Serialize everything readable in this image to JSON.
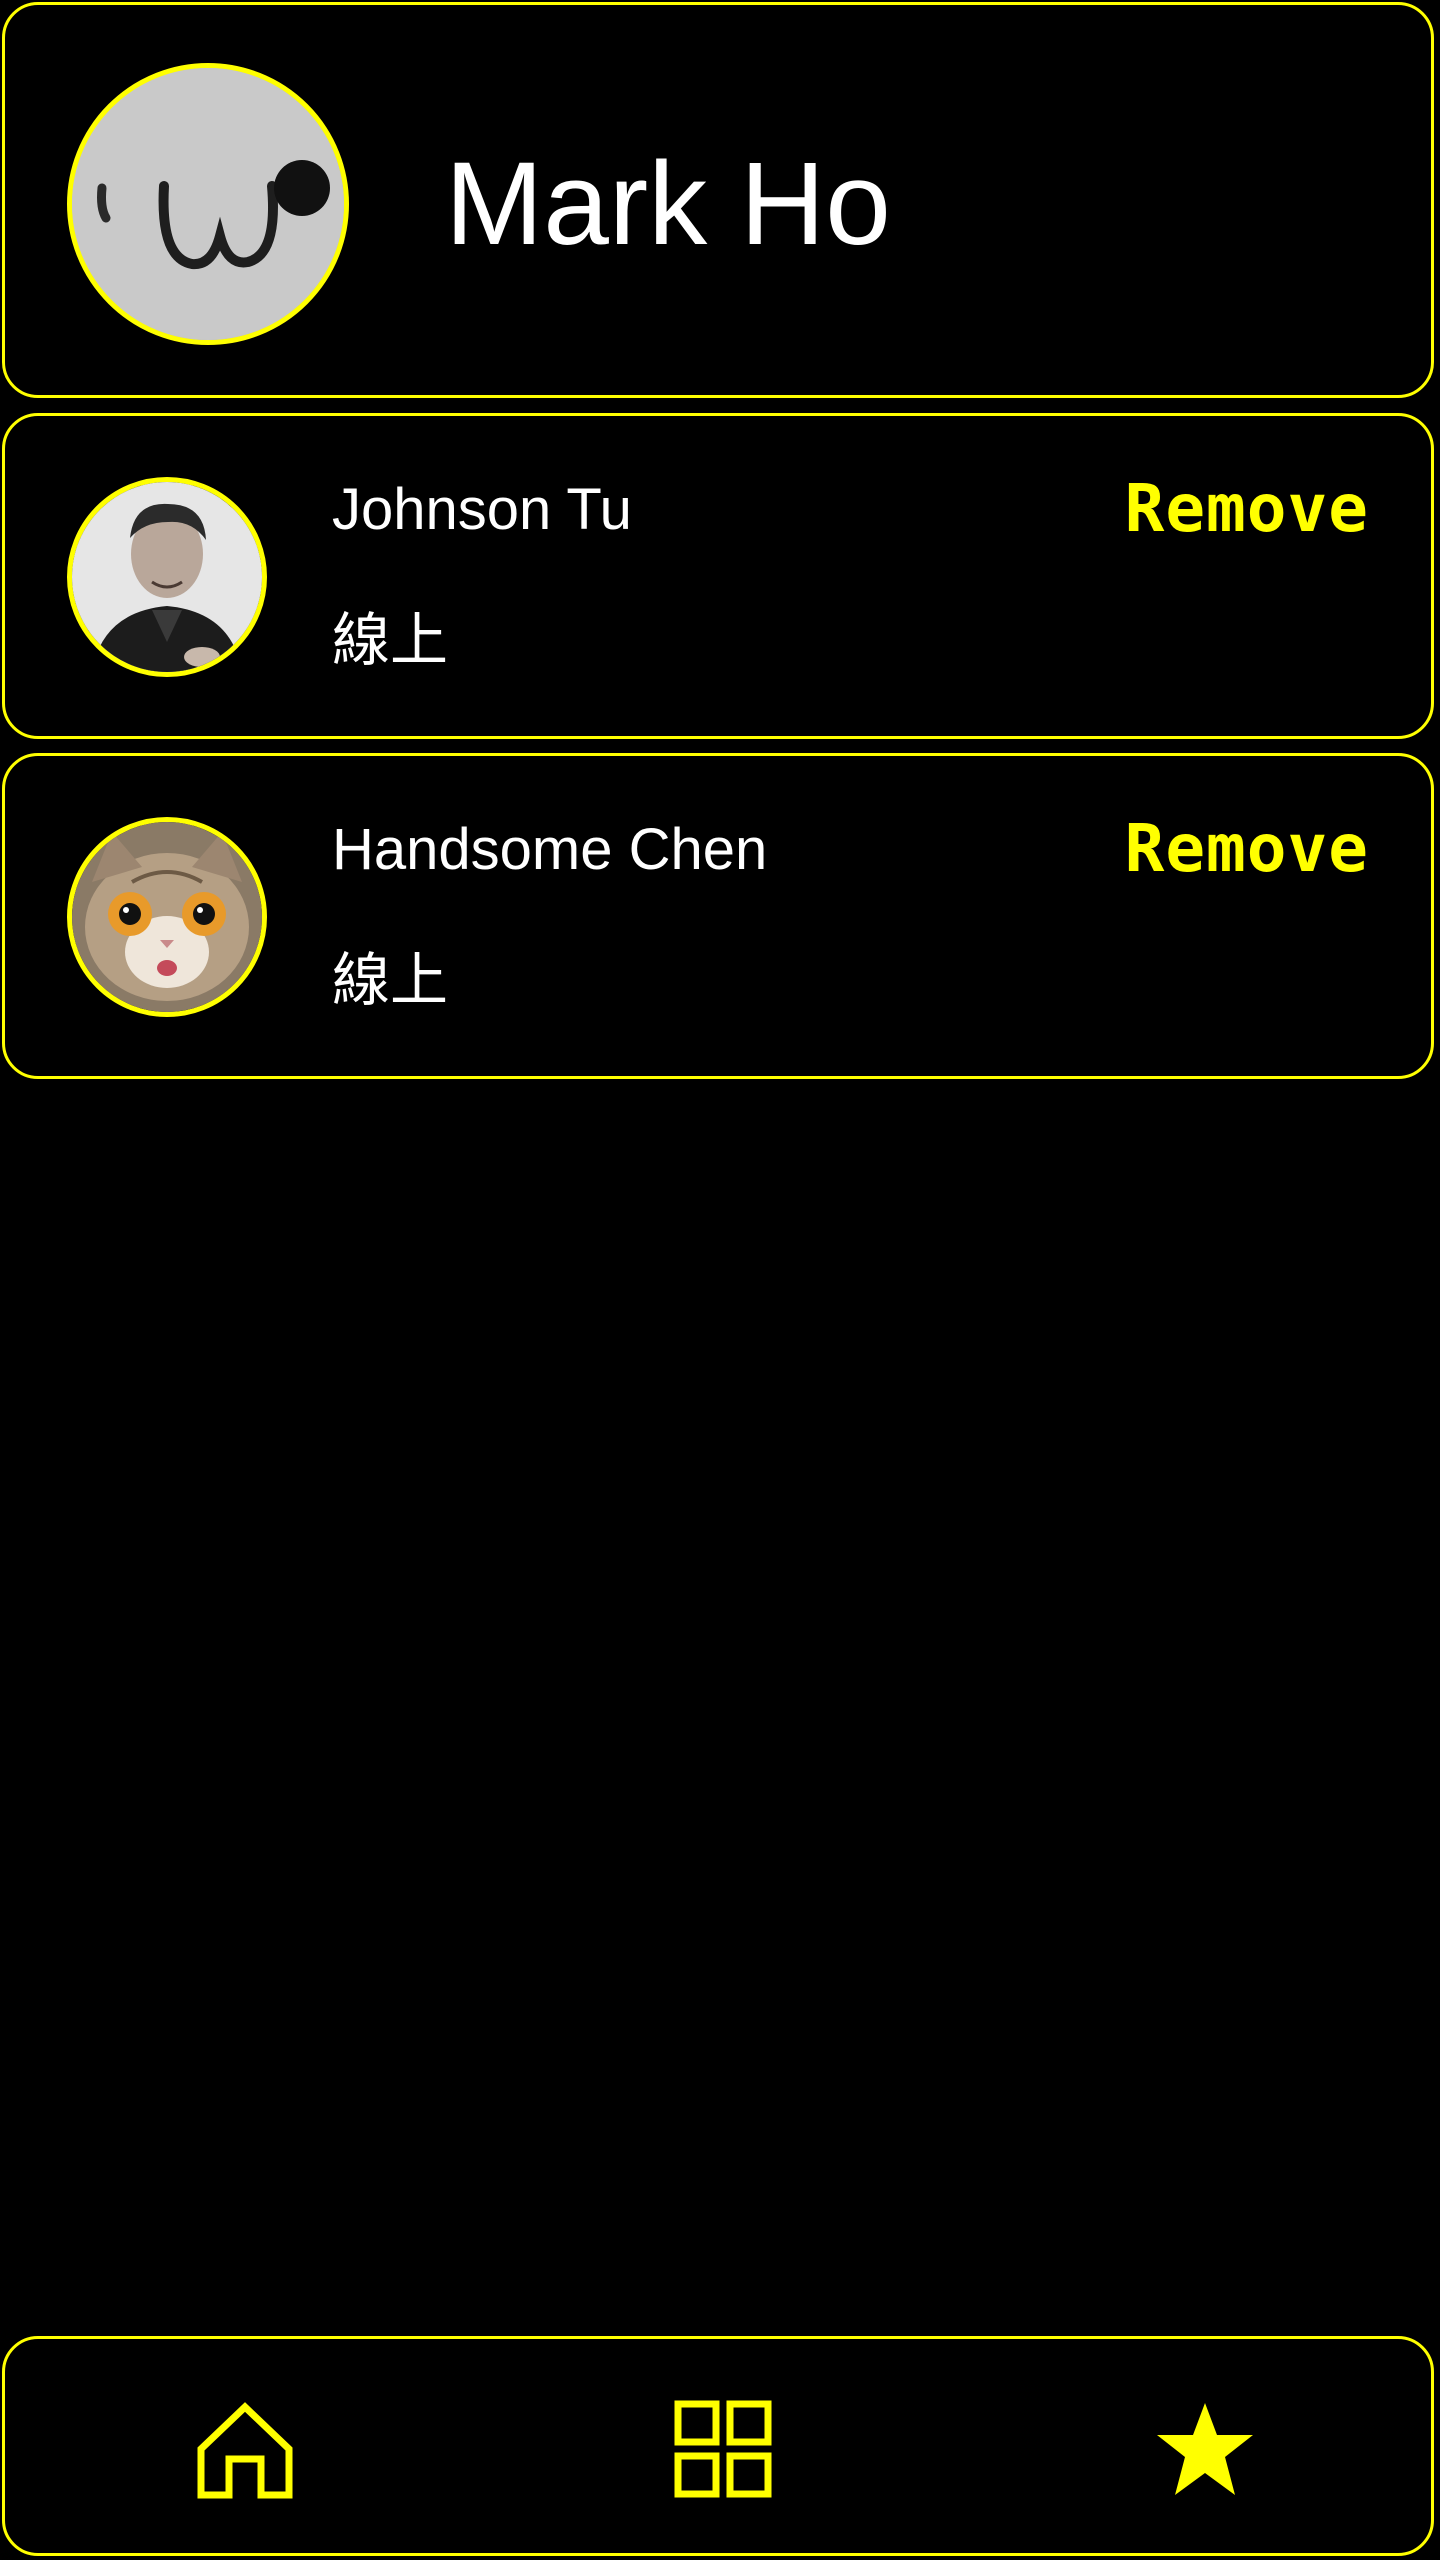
{
  "profile": {
    "name": "Mark Ho"
  },
  "friends": [
    {
      "name": "Johnson Tu",
      "status": "線上",
      "remove_label": "Remove"
    },
    {
      "name": "Handsome Chen",
      "status": "線上",
      "remove_label": "Remove"
    }
  ],
  "nav": {
    "items": [
      {
        "icon": "home-icon"
      },
      {
        "icon": "grid-icon"
      },
      {
        "icon": "star-icon",
        "active": true
      }
    ]
  },
  "colors": {
    "accent": "#ffff00",
    "background": "#000000",
    "text": "#ffffff"
  }
}
